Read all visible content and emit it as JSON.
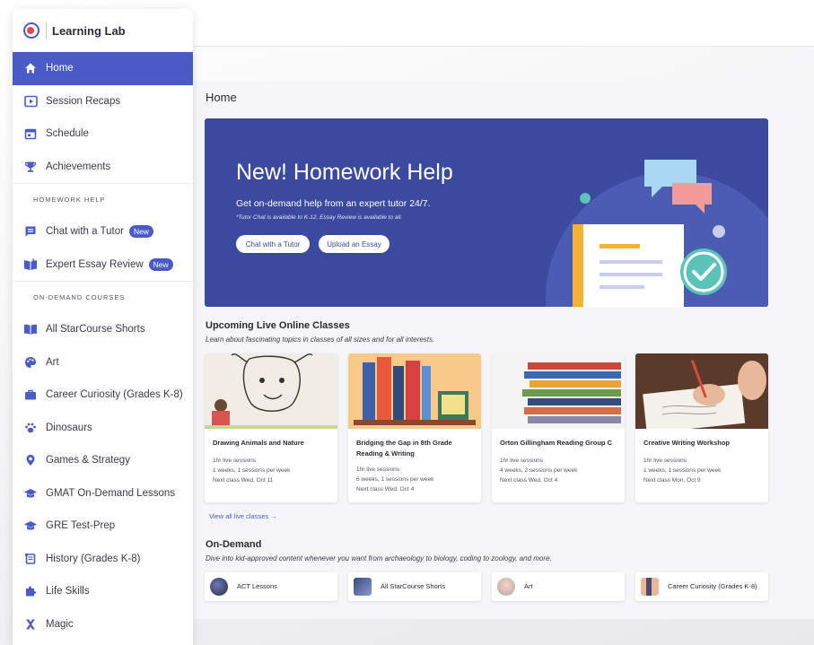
{
  "app": {
    "name": "Learning Lab"
  },
  "sidebar": {
    "items_top": [
      {
        "label": "Home",
        "icon": "home-icon",
        "active": true
      },
      {
        "label": "Session Recaps",
        "icon": "play-icon"
      },
      {
        "label": "Schedule",
        "icon": "calendar-icon"
      },
      {
        "label": "Achievements",
        "icon": "trophy-icon"
      }
    ],
    "homework_label": "HOMEWORK HELP",
    "homework_items": [
      {
        "label": "Chat with a Tutor",
        "icon": "chat-icon",
        "badge": "New"
      },
      {
        "label": "Expert Essay Review",
        "icon": "book-icon",
        "badge": "New"
      }
    ],
    "courses_label": "ON-DEMAND COURSES",
    "course_items": [
      {
        "label": "All StarCourse Shorts",
        "icon": "open-book-icon"
      },
      {
        "label": "Art",
        "icon": "palette-icon"
      },
      {
        "label": "Career Curiosity (Grades K-8)",
        "icon": "briefcase-icon"
      },
      {
        "label": "Dinosaurs",
        "icon": "paw-icon"
      },
      {
        "label": "Games & Strategy",
        "icon": "pin-icon"
      },
      {
        "label": "GMAT On-Demand Lessons",
        "icon": "graduation-cap-icon"
      },
      {
        "label": "GRE Test-Prep",
        "icon": "graduation-cap-icon"
      },
      {
        "label": "History (Grades K-8)",
        "icon": "scroll-icon"
      },
      {
        "label": "Life Skills",
        "icon": "puzzle-icon"
      },
      {
        "label": "Magic",
        "icon": "magic-icon"
      }
    ]
  },
  "main": {
    "page_title": "Home",
    "hero": {
      "title": "New! Homework Help",
      "subtitle": "Get on-demand help from an expert tutor 24/7.",
      "note": "*Tutor Chat is available to K-12. Essay Review is available to all.",
      "button_chat": "Chat with a Tutor",
      "button_essay": "Upload an Essay"
    },
    "live": {
      "title": "Upcoming Live Online Classes",
      "desc": "Learn about fascinating topics in classes of all sizes and for all interests.",
      "view_all": "View all live classes →",
      "cards": [
        {
          "title": "Drawing Animals and Nature",
          "l1": "1hr live sessions",
          "l2": "1 weeks, 1 sessions per week",
          "l3": "Next class Wed, Oct 11"
        },
        {
          "title": "Bridging the Gap in 8th Grade Reading & Writing",
          "l1": "1hr live sessions",
          "l2": "6 weeks, 1 sessions per week",
          "l3": "Next class Wed, Oct 4"
        },
        {
          "title": "Orton Gillingham Reading Group C",
          "l1": "1hr live sessions",
          "l2": "4 weeks, 2 sessions per week",
          "l3": "Next class Wed, Oct 4"
        },
        {
          "title": "Creative Writing Workshop",
          "l1": "1hr live sessions",
          "l2": "1 weeks, 1 sessions per week",
          "l3": "Next class Mon, Oct 9"
        }
      ]
    },
    "ondemand": {
      "title": "On-Demand",
      "desc": "Dive into kid-approved content whenever you want from archaeology to biology, coding to zoology, and more.",
      "items": [
        {
          "label": "ACT Lessons"
        },
        {
          "label": "All StarCourse Shorts"
        },
        {
          "label": "Art"
        },
        {
          "label": "Career Curiosity (Grades K-8)"
        }
      ]
    }
  },
  "colors": {
    "accent": "#4a5bc7",
    "hero_bg": "#3b4a9e",
    "teal": "#5bc3b8"
  }
}
